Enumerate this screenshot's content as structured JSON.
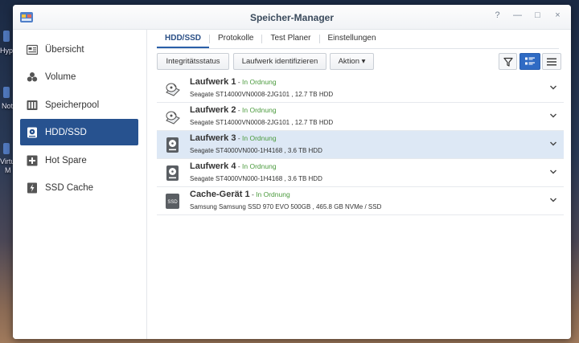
{
  "desktop": {
    "labels": [
      "Hyp",
      "Not",
      "Virtu",
      "M"
    ]
  },
  "window": {
    "title": "Speicher-Manager",
    "controls": {
      "help": "?",
      "minimize": "—",
      "maximize": "□",
      "close": "×"
    }
  },
  "sidebar": {
    "items": [
      {
        "label": "Übersicht",
        "icon": "overview-icon",
        "active": false
      },
      {
        "label": "Volume",
        "icon": "volume-icon",
        "active": false
      },
      {
        "label": "Speicherpool",
        "icon": "storage-pool-icon",
        "active": false
      },
      {
        "label": "HDD/SSD",
        "icon": "hdd-icon",
        "active": true
      },
      {
        "label": "Hot Spare",
        "icon": "hot-spare-icon",
        "active": false
      },
      {
        "label": "SSD Cache",
        "icon": "ssd-cache-icon",
        "active": false
      }
    ]
  },
  "tabs": [
    {
      "label": "HDD/SSD",
      "active": true
    },
    {
      "label": "Protokolle",
      "active": false
    },
    {
      "label": "Test Planer",
      "active": false
    },
    {
      "label": "Einstellungen",
      "active": false
    }
  ],
  "toolbar": {
    "integrity_label": "Integritätsstatus",
    "identify_label": "Laufwerk identifizieren",
    "action_label": "Aktion ▾"
  },
  "drives": [
    {
      "name": "Laufwerk 1",
      "sep": " - ",
      "status": "In Ordnung",
      "desc": "Seagate ST14000VN0008-2JG101 , 12.7 TB HDD",
      "icon": "hdd-platter-icon",
      "selected": false
    },
    {
      "name": "Laufwerk 2",
      "sep": " - ",
      "status": "In Ordnung",
      "desc": "Seagate ST14000VN0008-2JG101 , 12.7 TB HDD",
      "icon": "hdd-platter-icon",
      "selected": false
    },
    {
      "name": "Laufwerk 3",
      "sep": " - ",
      "status": "In Ordnung",
      "desc": "Seagate ST4000VN000-1H4168 , 3.6 TB HDD",
      "icon": "hdd-drive-icon",
      "selected": true
    },
    {
      "name": "Laufwerk 4",
      "sep": " - ",
      "status": "In Ordnung",
      "desc": "Seagate ST4000VN000-1H4168 , 3.6 TB HDD",
      "icon": "hdd-drive-icon",
      "selected": false
    },
    {
      "name": "Cache-Gerät 1",
      "sep": " - ",
      "status": "In Ordnung",
      "desc": "Samsung Samsung SSD 970 EVO 500GB , 465.8 GB NVMe / SSD",
      "icon": "ssd-icon",
      "icon_text": "SSD",
      "selected": false
    }
  ],
  "colors": {
    "accent": "#27528f",
    "ok": "#4a9a3c",
    "selected_row": "#dde8f5"
  }
}
